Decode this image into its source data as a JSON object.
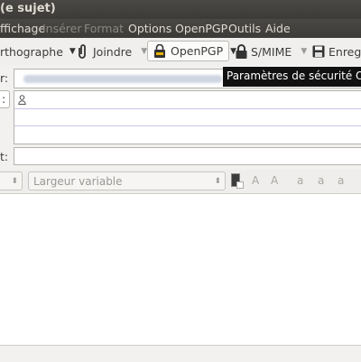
{
  "window": {
    "title": "(e sujet)"
  },
  "menu": [
    {
      "label": "ffichage",
      "enabled": true
    },
    {
      "label": "Insérer",
      "enabled": false
    },
    {
      "label": "Format",
      "enabled": false
    },
    {
      "label": "Options",
      "enabled": true
    },
    {
      "label": "OpenPGP",
      "enabled": true
    },
    {
      "label": "Outils",
      "enabled": true
    },
    {
      "label": "Aide",
      "enabled": true
    }
  ],
  "toolbar": {
    "spelling_label": "rthographe",
    "attach_label": "Joindre",
    "openpgp_label": "OpenPGP",
    "smime_label": "S/MIME",
    "save_label": "Enregis"
  },
  "tooltip": {
    "text": "Paramètres de sécurité OpenPGP"
  },
  "header": {
    "from_label": "r:",
    "recipient_type_label": ":",
    "subject_label": "t:"
  },
  "format": {
    "font_select": "Largeur variable"
  },
  "icons": {
    "attach": "paperclip-icon",
    "openpgp": "openpgp-key-icon",
    "smime": "lock-icon",
    "save": "floppy-disk-icon",
    "contact": "person-icon"
  },
  "colors": {
    "menubar": "#3c3b37",
    "menu_text": "#dfdbd2",
    "tooltip_bg": "#111111",
    "row_divider": "#c8c6e8"
  }
}
